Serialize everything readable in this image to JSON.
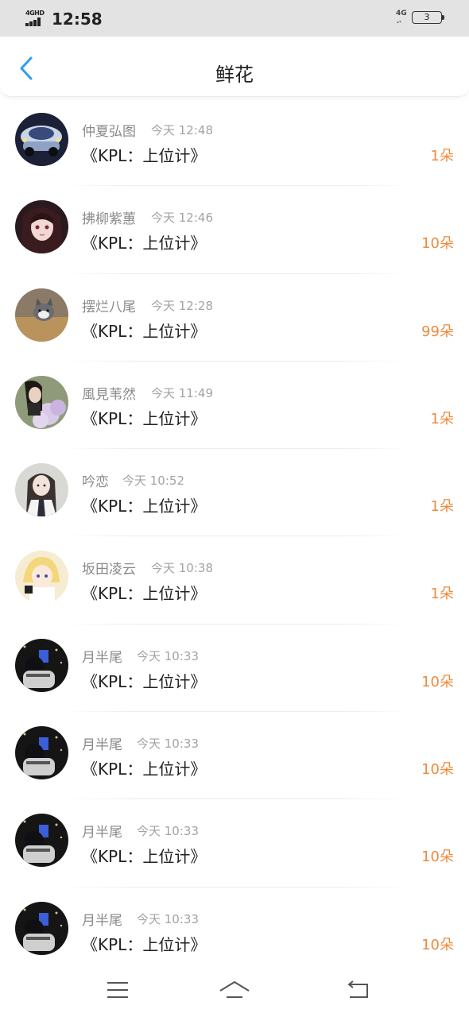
{
  "status_bar": {
    "network": "4GHD",
    "time": "12:58",
    "network_right": "4G",
    "battery": "3"
  },
  "header": {
    "title": "鲜花",
    "back_icon": "chevron-left-icon"
  },
  "colors": {
    "accent_back": "#2f9ef0",
    "count": "#f08a3c",
    "name": "#8a8a8a",
    "time": "#a3a3a3"
  },
  "items": [
    {
      "name": "仲夏弘图",
      "time": "今天 12:48",
      "book": "《KPL：上位计》",
      "count": "1朵",
      "avatar": "car-avatar"
    },
    {
      "name": "拂柳紫蕙",
      "time": "今天 12:46",
      "book": "《KPL：上位计》",
      "count": "10朵",
      "avatar": "anime-girl-avatar"
    },
    {
      "name": "摆烂八尾",
      "time": "今天 12:28",
      "book": "《KPL：上位计》",
      "count": "99朵",
      "avatar": "cat-avatar"
    },
    {
      "name": "風見苇然",
      "time": "今天 11:49",
      "book": "《KPL：上位计》",
      "count": "1朵",
      "avatar": "flowers-avatar"
    },
    {
      "name": "吟恋",
      "time": "今天 10:52",
      "book": "《KPL：上位计》",
      "count": "1朵",
      "avatar": "portrait-avatar"
    },
    {
      "name": "坂田凌云",
      "time": "今天 10:38",
      "book": "《KPL：上位计》",
      "count": "1朵",
      "avatar": "cartoon-avatar"
    },
    {
      "name": "月半尾",
      "time": "今天 10:33",
      "book": "《KPL：上位计》",
      "count": "10朵",
      "avatar": "night-avatar"
    },
    {
      "name": "月半尾",
      "time": "今天 10:33",
      "book": "《KPL：上位计》",
      "count": "10朵",
      "avatar": "night-avatar"
    },
    {
      "name": "月半尾",
      "time": "今天 10:33",
      "book": "《KPL：上位计》",
      "count": "10朵",
      "avatar": "night-avatar"
    },
    {
      "name": "月半尾",
      "time": "今天 10:33",
      "book": "《KPL：上位计》",
      "count": "10朵",
      "avatar": "night-avatar"
    }
  ],
  "bottom_nav": {
    "menu_icon": "menu-icon",
    "home_icon": "home-icon",
    "back_icon": "return-icon"
  }
}
